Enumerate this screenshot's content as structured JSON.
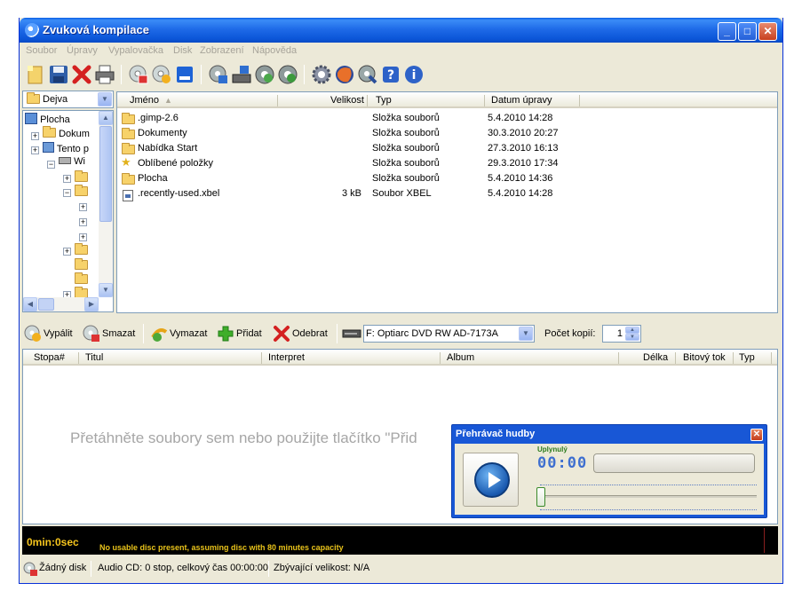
{
  "window": {
    "title": "Zvuková kompilace",
    "buttons": {
      "minimize": "_",
      "maximize": "□",
      "close": "✕"
    }
  },
  "menu": [
    "Soubor",
    "Úpravy",
    "Vypalovačka",
    "Disk",
    "Zobrazení",
    "Nápověda"
  ],
  "location": {
    "current": "Dejva"
  },
  "tree": {
    "items": [
      {
        "label": "Plocha"
      },
      {
        "label": "Dokum"
      },
      {
        "label": "Tento p"
      },
      {
        "label": "Wi"
      }
    ]
  },
  "file_list": {
    "columns": {
      "name": "Jméno",
      "size": "Velikost",
      "type": "Typ",
      "date": "Datum úpravy"
    },
    "rows": [
      {
        "name": ".gimp-2.6",
        "size": "",
        "type": "Složka souborů",
        "date": "5.4.2010 14:28"
      },
      {
        "name": "Dokumenty",
        "size": "",
        "type": "Složka souborů",
        "date": "30.3.2010 20:27"
      },
      {
        "name": "Nabídka Start",
        "size": "",
        "type": "Složka souborů",
        "date": "27.3.2010 16:13"
      },
      {
        "name": "Oblíbené položky",
        "size": "",
        "type": "Složka souborů",
        "date": "29.3.2010 17:34"
      },
      {
        "name": "Plocha",
        "size": "",
        "type": "Složka souborů",
        "date": "5.4.2010 14:36"
      },
      {
        "name": ".recently-used.xbel",
        "size": "3 kB",
        "type": "Soubor XBEL",
        "date": "5.4.2010 14:28"
      }
    ]
  },
  "actions": {
    "burn": "Vypálit",
    "erase": "Smazat",
    "clear": "Vymazat",
    "add": "Přidat",
    "remove": "Odebrat",
    "drive": "F: Optiarc DVD RW AD-7173A",
    "copies_label": "Počet kopií:",
    "copies_value": "1"
  },
  "tracks": {
    "columns": {
      "track": "Stopa#",
      "title": "Titul",
      "artist": "Interpret",
      "album": "Album",
      "length": "Délka",
      "bitrate": "Bitový tok",
      "type": "Typ"
    },
    "placeholder": "Přetáhněte soubory sem nebo použijte tlačítko \"Přid"
  },
  "capacity": {
    "time": "0min:0sec",
    "message": "No usable disc present, assuming disc with 80 minutes capacity"
  },
  "status": {
    "disc": "Žádný disk",
    "info": "Audio CD: 0 stop, celkový čas 00:00:00",
    "remaining": "Zbývající velikost: N/A"
  },
  "player": {
    "title": "Přehrávač hudby",
    "close": "✕",
    "elapsed_label": "Uplynulý",
    "elapsed": "00:00",
    "progress": 0
  },
  "icons": [
    "new-project-icon",
    "save-icon",
    "delete-icon",
    "print-icon",
    "burn-disc-icon",
    "erase-disc-icon",
    "blue-square-icon",
    "copy-disc-icon",
    "drive-info-icon",
    "disc-tool-icon",
    "disc-tool2-icon",
    "settings-gear-icon",
    "firefox-icon",
    "search-icon",
    "help-icon",
    "info-icon"
  ]
}
